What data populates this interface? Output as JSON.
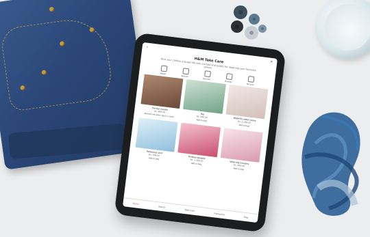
{
  "scene": {
    "background_color": "#ecedee",
    "props": [
      "denim-jeans",
      "sewing-buttons",
      "water-glass",
      "blue-yarn-bundle",
      "tablet"
    ]
  },
  "tablet_app": {
    "header": {
      "title": "H&M Take Care",
      "subtitle": "Give your clothes a longer life with our tips and guides for repairing your favourite pieces"
    },
    "categories": [
      {
        "label": "Repair",
        "icon": "needle-icon"
      },
      {
        "label": "Refresh",
        "icon": "spray-icon"
      },
      {
        "label": "Remake",
        "icon": "scissors-icon"
      },
      {
        "label": "Rewear",
        "icon": "hanger-icon"
      },
      {
        "label": "Recycle",
        "icon": "recycle-icon"
      }
    ],
    "products": [
      {
        "name": "Tie-dye hoodie",
        "price": "Rs. 899.00",
        "action": "Remind me when back in stock",
        "color": "#8a6a56"
      },
      {
        "name": "Top",
        "price": "Rs. 499.00",
        "action": "Add to bag",
        "color": "#86b39a"
      },
      {
        "name": "Wide-fit cotton jeans",
        "price": "Rs. 1,299.00",
        "action": "Add to bag",
        "color": "#e2d4cf"
      },
      {
        "name": "Patterned shirt",
        "price": "Rs. 699.00",
        "action": "Add to bag",
        "color": "#9ec7de"
      },
      {
        "name": "Knitted sweater",
        "price": "Rs. 1,499.00",
        "action": "Add to bag",
        "color": "#d66a8a"
      },
      {
        "name": "Wide-leg trousers",
        "price": "Rs. 999.00",
        "action": "Add to bag",
        "color": "#e3b4c4"
      }
    ],
    "tabbar": [
      {
        "label": "Home",
        "active": true
      },
      {
        "label": "Search",
        "active": false
      },
      {
        "label": "Take Care",
        "active": false
      },
      {
        "label": "Favourites",
        "active": false
      },
      {
        "label": "Bag",
        "active": false
      }
    ]
  }
}
